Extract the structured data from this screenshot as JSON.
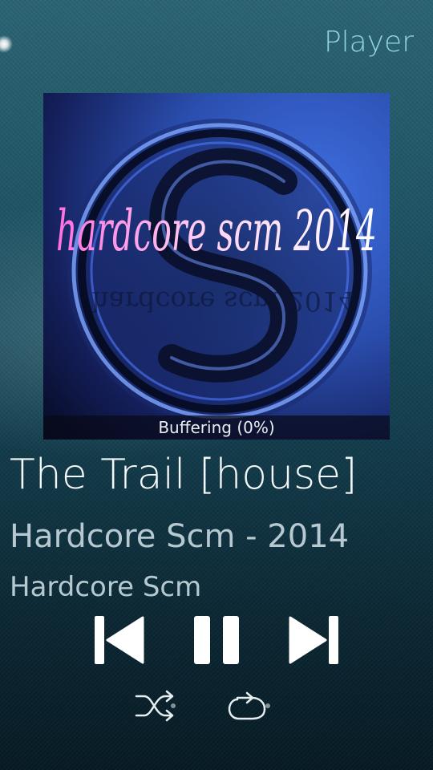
{
  "header": {
    "title": "Player"
  },
  "album_art": {
    "art_text": "hardcore scm 2014",
    "buffering_text": "Buffering (0%)"
  },
  "track": {
    "title": "The Trail [house]",
    "album": "Hardcore Scm - 2014",
    "artist": "Hardcore Scm"
  },
  "controls": {
    "previous": "previous-icon",
    "pause": "pause-icon",
    "next": "next-icon",
    "shuffle": "shuffle-icon",
    "repeat": "repeat-icon"
  },
  "colors": {
    "accent": "#8fd3e3",
    "text": "#f4f7f8",
    "secondary_text": "#b6c9d0"
  }
}
